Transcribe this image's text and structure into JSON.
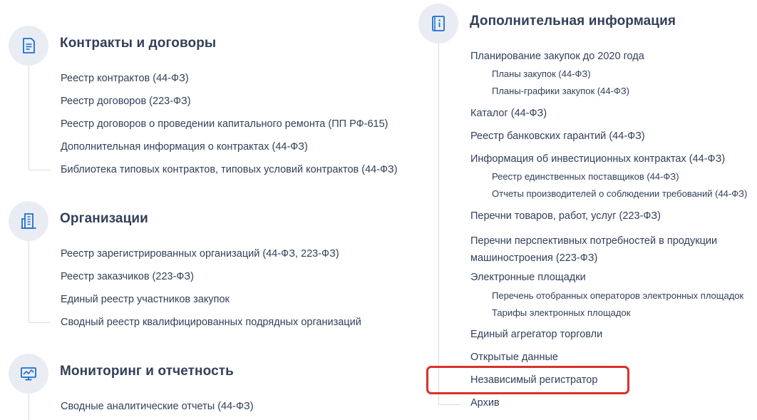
{
  "left": {
    "contracts": {
      "title": "Контракты и договоры",
      "icon": "document-icon",
      "items": [
        "Реестр контрактов (44-ФЗ)",
        "Реестр договоров (223-ФЗ)",
        "Реестр договоров о проведении капитального ремонта (ПП РФ-615)",
        "Дополнительная информация о контрактах (44-ФЗ)",
        "Библиотека типовых контрактов, типовых условий контрактов (44-ФЗ)"
      ]
    },
    "organizations": {
      "title": "Организации",
      "icon": "building-icon",
      "items": [
        "Реестр зарегистрированных организаций (44-ФЗ, 223-ФЗ)",
        "Реестр заказчиков (223-ФЗ)",
        "Единый реестр участников закупок",
        "Сводный реестр квалифицированных подрядных организаций"
      ]
    },
    "monitoring": {
      "title": "Мониторинг и отчетность",
      "icon": "monitor-chart-icon",
      "items": [
        "Сводные аналитические отчеты (44-ФЗ)"
      ]
    }
  },
  "right": {
    "title": "Дополнительная информация",
    "icon": "info-book-icon",
    "items": {
      "planning": "Планирование закупок до 2020 года",
      "plans": "Планы закупок (44-ФЗ)",
      "schedules": "Планы-графики закупок (44-ФЗ)",
      "catalog": "Каталог (44-ФЗ)",
      "guarantees": "Реестр банковских гарантий (44-ФЗ)",
      "investment": "Информация об инвестиционных контрактах (44-ФЗ)",
      "sole_suppliers": "Реестр единственных поставщиков (44-ФЗ)",
      "producer_reports": "Отчеты производителей о соблюдении требований (44-ФЗ)",
      "goods_lists": "Перечни товаров, работ, услуг (223-ФЗ)",
      "needs_line1": "Перечни перспективных потребностей в продукции",
      "needs_line2": "машиностроения (223-ФЗ)",
      "platforms": "Электронные площадки",
      "operators": "Перечень отобранных операторов электронных площадок",
      "tariffs": "Тарифы электронных площадок",
      "aggregator": "Единый агрегатор торговли",
      "open_data": "Открытые данные",
      "registrar": "Независимый регистратор",
      "archive": "Архив"
    }
  },
  "colors": {
    "text": "#334059",
    "icon": "#1f6fd1",
    "icon_bg": "#e9edf3",
    "tree_line": "#d7dde6",
    "highlight": "#d9312a"
  }
}
